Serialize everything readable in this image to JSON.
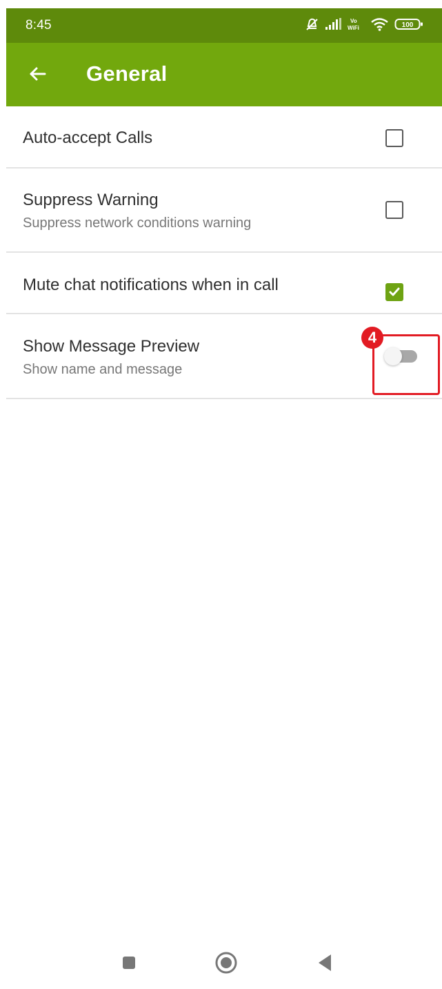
{
  "status_bar": {
    "time": "8:45",
    "battery_level": "100",
    "background_color": "#5e8a0b",
    "icons": [
      "alarm-off-icon",
      "signal-icon",
      "vowifi-icon",
      "wifi-icon",
      "battery-icon"
    ]
  },
  "app_bar": {
    "title": "General",
    "background_color": "#72a80d",
    "back_icon": "arrow-left-icon"
  },
  "settings": [
    {
      "title": "Auto-accept Calls",
      "control": "checkbox",
      "checked": false
    },
    {
      "title": "Suppress Warning",
      "subtitle": "Suppress network conditions warning",
      "control": "checkbox",
      "checked": false
    },
    {
      "title": "Mute chat notifications when in call",
      "control": "checkbox",
      "checked": true,
      "checked_color": "#6ea313"
    },
    {
      "title": "Show Message Preview",
      "subtitle": "Show name and message",
      "control": "switch",
      "enabled": false
    }
  ],
  "annotation": {
    "badge": "4",
    "color": "#e21b23"
  },
  "navigation_bar": {
    "buttons": [
      "recent-apps-icon",
      "home-icon",
      "back-triangle-icon"
    ]
  }
}
